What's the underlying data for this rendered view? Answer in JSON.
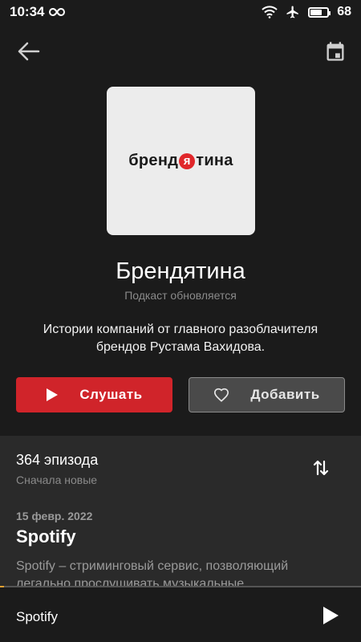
{
  "status_bar": {
    "time": "10:34",
    "battery": "68",
    "battery_level": 0.68
  },
  "icons": {
    "back": "arrow-left",
    "calendar": "calendar",
    "sort": "sort-arrows",
    "play": "play",
    "heart": "heart"
  },
  "podcast": {
    "logo_pre": "бренд",
    "logo_mark": "я",
    "logo_post": "тина",
    "title": "Брендятина",
    "status": "Подкаст обновляется",
    "description": "Истории компаний от главного разоблачителя брендов Рустама Вахидова."
  },
  "actions": {
    "listen_label": "Слушать",
    "add_label": "Добавить"
  },
  "episodes": {
    "count_label": "364 эпизода",
    "sort_label": "Сначала новые",
    "items": [
      {
        "date": "15 февр. 2022",
        "title": "Spotify",
        "description": "Spotify – стриминговый сервис, позволяющий легально прослушивать музыкальные"
      }
    ]
  },
  "player": {
    "title": "Spotify",
    "progress": 0.01
  },
  "colors": {
    "accent_red": "#d0242a",
    "background": "#1b1b1b",
    "list_background": "#2a2a2a"
  }
}
